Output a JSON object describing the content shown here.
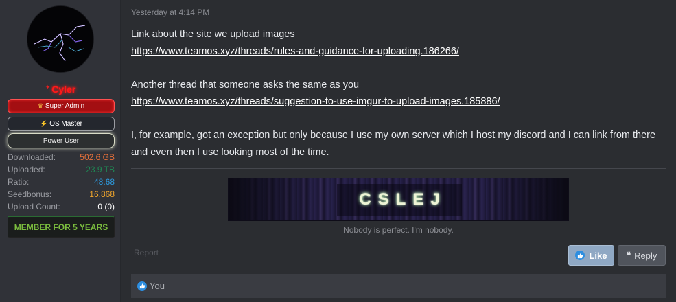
{
  "user": {
    "username": "Cyler",
    "badges": {
      "super_admin": "Super Admin",
      "os_master": "OS Master",
      "power_user": "Power User"
    },
    "stats": [
      {
        "label": "Downloaded:",
        "value": "502.6 GB",
        "color": "#e8713b"
      },
      {
        "label": "Uploaded:",
        "value": "23.9 TB",
        "color": "#1f8a55"
      },
      {
        "label": "Ratio:",
        "value": "48.68",
        "color": "#2d9be0"
      },
      {
        "label": "Seedbonus:",
        "value": "16,868",
        "color": "#f1a62c"
      },
      {
        "label": "Upload Count:",
        "value": "0 (0)",
        "color": "#ffffff"
      }
    ],
    "member_for": "MEMBER FOR 5 YEARS"
  },
  "post": {
    "timestamp": "Yesterday at 4:14 PM",
    "line1": "Link about the site we upload images",
    "link1": "https://www.teamos.xyz/threads/rules-and-guidance-for-uploading.186266/",
    "line2": "Another thread that someone asks the same as you",
    "link2": "https://www.teamos.xyz/threads/suggestion-to-use-imgur-to-upload-images.185886/",
    "line3": "I, for example, got an exception but only because I use my own server which I host my discord and I can link from there and even then I use looking most of the time."
  },
  "signature": {
    "banner_text": "CSLEJ",
    "tagline": "Nobody is perfect. I'm nobody."
  },
  "actions": {
    "report": "Report",
    "like": "Like",
    "reply": "Reply"
  },
  "reactions": {
    "text": "You"
  },
  "colors": {
    "username": "#ff1a1a",
    "admin_badge": "#a30f12",
    "like_button": "#8fa8c4",
    "member_text": "#7bbd3e"
  }
}
